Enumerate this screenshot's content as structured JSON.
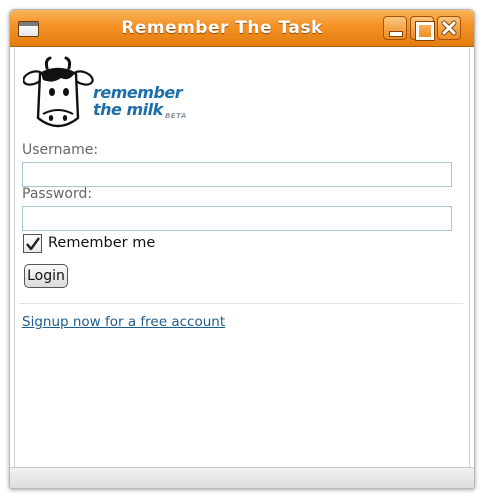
{
  "window": {
    "title": "Remember The Task"
  },
  "logo": {
    "line1": "remember",
    "line2": "the milk",
    "beta": "BETA"
  },
  "form": {
    "username_label": "Username:",
    "username_value": "",
    "password_label": "Password:",
    "password_value": "",
    "remember_label": "Remember me",
    "remember_checked": true,
    "login_label": "Login"
  },
  "signup": {
    "link_text": "Signup now for a free account"
  },
  "colors": {
    "titlebar": "#f59125",
    "link": "#1d5d8c",
    "logo": "#1f6ea9"
  }
}
